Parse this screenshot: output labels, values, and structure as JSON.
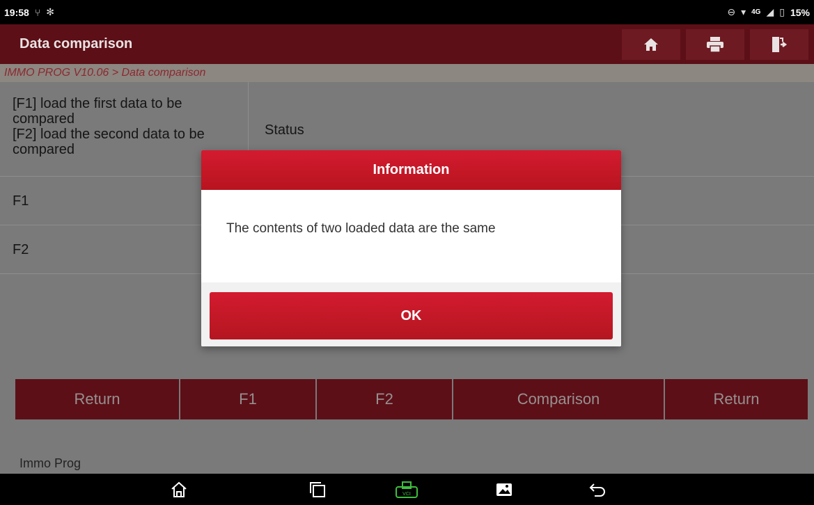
{
  "statusbar": {
    "time": "19:58",
    "battery": "15%",
    "network": "4G"
  },
  "titlebar": {
    "title": "Data comparison",
    "icons": [
      "home-icon",
      "print-icon",
      "exit-icon"
    ]
  },
  "breadcrumb": "IMMO PROG V10.06 > Data comparison",
  "table": {
    "header_left": "[F1] load the first data to be compared\n[F2] load the second data to be compared",
    "header_right": "Status",
    "rows": [
      {
        "label": "F1"
      },
      {
        "label": "F2"
      }
    ]
  },
  "buttons": [
    "Return",
    "F1",
    "F2",
    "Comparison",
    "Return"
  ],
  "footer": {
    "label": "Immo Prog"
  },
  "dialog": {
    "title": "Information",
    "message": "The contents of two loaded data are the same",
    "ok": "OK"
  },
  "navbar": {
    "icons": [
      "home-icon",
      "recent-apps-icon",
      "vci-icon",
      "gallery-icon",
      "back-icon"
    ]
  }
}
